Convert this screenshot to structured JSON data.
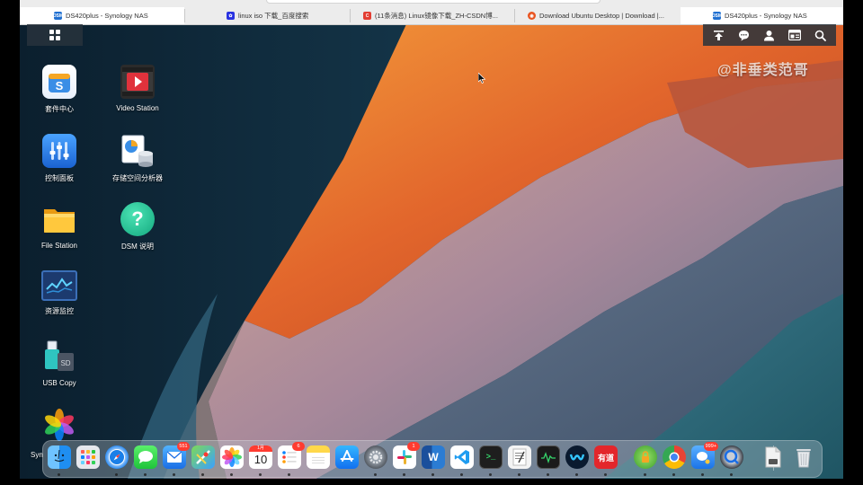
{
  "browser": {
    "tabs": [
      {
        "title": "DS420plus - Synology NAS",
        "favicon": "dsm-icon",
        "color": "#1f6fd1",
        "active": true
      },
      {
        "title": "linux iso 下载_百度搜索",
        "favicon": "baidu-paw-icon",
        "color": "#2932e1",
        "active": false
      },
      {
        "title": "(11条消息) Linux镜像下载_ZH-CSDN博...",
        "favicon": "csdn-icon",
        "color": "#e33e33",
        "active": false
      },
      {
        "title": "Download Ubuntu Desktop | Download |...",
        "favicon": "ubuntu-icon",
        "color": "#e95420",
        "active": false
      },
      {
        "title": "DS420plus - Synology NAS",
        "favicon": "dsm-icon",
        "color": "#1f6fd1",
        "active": true
      }
    ]
  },
  "desktop": {
    "icons": [
      {
        "label": "套件中心",
        "icon": "package-center-icon"
      },
      {
        "label": "Video Station",
        "icon": "video-station-icon"
      },
      {
        "label": "控制面板",
        "icon": "control-panel-icon"
      },
      {
        "label": "存储空间分析器",
        "icon": "storage-analyzer-icon"
      },
      {
        "label": "File Station",
        "icon": "file-station-icon"
      },
      {
        "label": "DSM 说明",
        "icon": "dsm-help-icon"
      },
      {
        "label": "资源监控",
        "icon": "resource-monitor-icon"
      },
      {
        "label": "USB Copy",
        "icon": "usb-copy-icon"
      },
      {
        "label": "Syn",
        "icon": "synology-photos-icon"
      }
    ],
    "watermark": "@非垂类范哥"
  },
  "dsm_toolbar": {
    "icons": [
      "upload-icon",
      "chat-icon",
      "user-icon",
      "widgets-icon",
      "search-icon"
    ]
  },
  "dock": {
    "apps": [
      {
        "name": "finder-icon",
        "badge": ""
      },
      {
        "name": "launchpad-icon",
        "badge": ""
      },
      {
        "name": "safari-icon",
        "badge": ""
      },
      {
        "name": "messages-icon",
        "badge": ""
      },
      {
        "name": "mail-icon",
        "badge": "551"
      },
      {
        "name": "maps-icon",
        "badge": ""
      },
      {
        "name": "photos-icon",
        "badge": ""
      },
      {
        "name": "calendar-icon",
        "badge": "",
        "month": "1月",
        "day": "10"
      },
      {
        "name": "reminders-icon",
        "badge": "6"
      },
      {
        "name": "notes-icon",
        "badge": ""
      },
      {
        "name": "app-store-icon",
        "badge": ""
      },
      {
        "name": "system-preferences-icon",
        "badge": ""
      },
      {
        "name": "slack-icon",
        "badge": "1"
      },
      {
        "name": "word-icon",
        "badge": ""
      },
      {
        "name": "vscode-icon",
        "badge": ""
      },
      {
        "name": "terminal-icon",
        "badge": ""
      },
      {
        "name": "textedit-icon",
        "badge": ""
      },
      {
        "name": "activity-monitor-icon",
        "badge": ""
      },
      {
        "name": "webex-icon",
        "badge": ""
      },
      {
        "name": "youdao-icon",
        "badge": "",
        "text": "有道"
      },
      {
        "name": "vpn-icon",
        "badge": ""
      },
      {
        "name": "chrome-icon",
        "badge": ""
      },
      {
        "name": "wechat-work-icon",
        "badge": "999+"
      },
      {
        "name": "quicktime-icon",
        "badge": ""
      },
      {
        "name": "document-icon",
        "badge": ""
      },
      {
        "name": "trash-icon",
        "badge": ""
      }
    ]
  }
}
